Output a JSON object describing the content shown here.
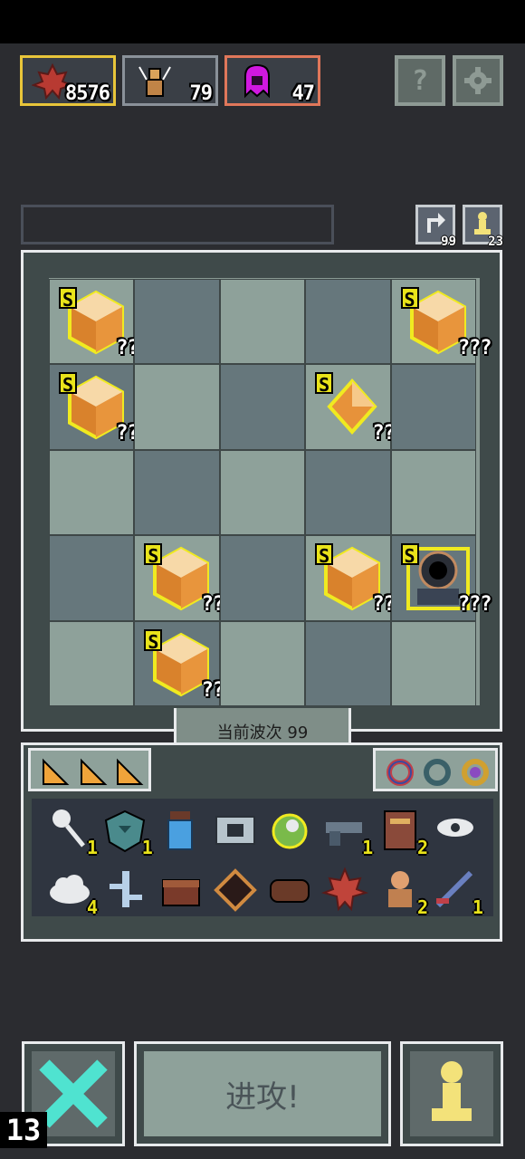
{
  "resources": [
    {
      "icon": "maple-leaf-icon",
      "count": "8576"
    },
    {
      "icon": "wooden-doll-icon",
      "count": "79"
    },
    {
      "icon": "purple-ghost-icon",
      "count": "47"
    }
  ],
  "top_buttons": {
    "help_label": "?",
    "settings_icon": "gear-icon"
  },
  "counters": {
    "rerolls": "99",
    "pawns": "23"
  },
  "board": {
    "rows": 5,
    "cols": 5,
    "items": [
      {
        "row": 0,
        "col": 0,
        "type": "large-crystal",
        "rank": "S",
        "label": "???"
      },
      {
        "row": 0,
        "col": 4,
        "type": "large-crystal",
        "rank": "S",
        "label": "???"
      },
      {
        "row": 1,
        "col": 0,
        "type": "large-crystal",
        "rank": "S",
        "label": "???"
      },
      {
        "row": 1,
        "col": 3,
        "type": "small-crystal",
        "rank": "S",
        "label": "???"
      },
      {
        "row": 3,
        "col": 1,
        "type": "large-crystal",
        "rank": "S",
        "label": "???"
      },
      {
        "row": 3,
        "col": 3,
        "type": "large-crystal",
        "rank": "S",
        "label": "???"
      },
      {
        "row": 3,
        "col": 4,
        "type": "dark-turret",
        "rank": "S",
        "label": "???"
      },
      {
        "row": 4,
        "col": 1,
        "type": "large-crystal",
        "rank": "S",
        "label": "???"
      }
    ]
  },
  "wave_label": "当前波次 99",
  "inventory": {
    "tab_icons": [
      "orange-shard-icon",
      "orange-shard-icon",
      "orange-shard-icon"
    ],
    "ring_icons": [
      "red-ring-icon",
      "teal-ring-icon",
      "gold-ring-icon"
    ],
    "row1": [
      {
        "icon": "spoon-icon",
        "count": "1"
      },
      {
        "icon": "heart-gem-icon",
        "count": "1"
      },
      {
        "icon": "potion-jar-icon",
        "count": ""
      },
      {
        "icon": "camera-icon",
        "count": ""
      },
      {
        "icon": "green-orb-icon",
        "count": ""
      },
      {
        "icon": "pistol-icon",
        "count": "1"
      },
      {
        "icon": "spellbook-icon",
        "count": "2"
      },
      {
        "icon": "eye-hand-icon",
        "count": ""
      }
    ],
    "row2": [
      {
        "icon": "cloud-icon",
        "count": "4"
      },
      {
        "icon": "branch-icon",
        "count": ""
      },
      {
        "icon": "treasure-chest-icon",
        "count": ""
      },
      {
        "icon": "rune-diamond-icon",
        "count": ""
      },
      {
        "icon": "log-icon",
        "count": ""
      },
      {
        "icon": "red-maple-icon",
        "count": ""
      },
      {
        "icon": "bust-statue-icon",
        "count": "2"
      },
      {
        "icon": "sword-icon",
        "count": "1"
      }
    ]
  },
  "bottom": {
    "cancel_icon": "close-icon",
    "attack_label": "进攻!",
    "pawn_icon": "pawn-icon"
  },
  "turn_number": "13"
}
